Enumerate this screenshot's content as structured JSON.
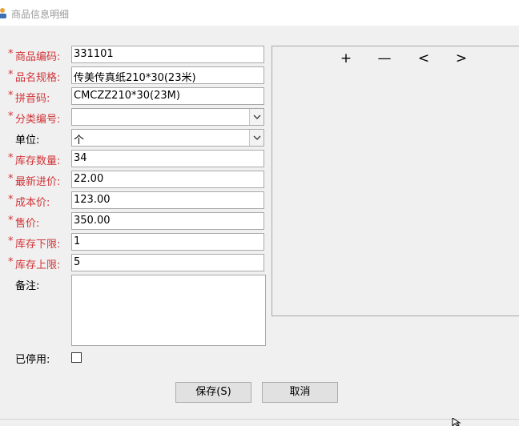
{
  "window": {
    "title": "商品信息明细"
  },
  "form": {
    "required_mark": "*",
    "fields": [
      {
        "label": "商品编码:",
        "value": "331101",
        "required": true
      },
      {
        "label": "品名规格:",
        "value": "传美传真纸210*30(23米)",
        "required": true
      },
      {
        "label": "拼音码:",
        "value": "CMCZZ210*30(23M)",
        "required": true
      },
      {
        "label": "分类编号:",
        "value": "",
        "required": true
      },
      {
        "label": "单位:",
        "value": "个",
        "required": false
      },
      {
        "label": "库存数量:",
        "value": "34",
        "required": true
      },
      {
        "label": "最新进价:",
        "value": "22.00",
        "required": true
      },
      {
        "label": "成本价:",
        "value": "123.00",
        "required": true
      },
      {
        "label": "售价:",
        "value": "350.00",
        "required": true
      },
      {
        "label": "库存下限:",
        "value": "1",
        "required": true
      },
      {
        "label": "库存上限:",
        "value": "5",
        "required": true
      }
    ],
    "remark": {
      "label": "备注:",
      "value": ""
    },
    "disabled": {
      "label": "已停用:",
      "checked": false
    }
  },
  "image_toolbar": {
    "add": "+",
    "remove": "—",
    "prev": "<",
    "next": ">"
  },
  "buttons": {
    "save": "保存(S)",
    "cancel": "取消"
  },
  "colors": {
    "required": "#d13438",
    "background": "#f0f0f0"
  }
}
